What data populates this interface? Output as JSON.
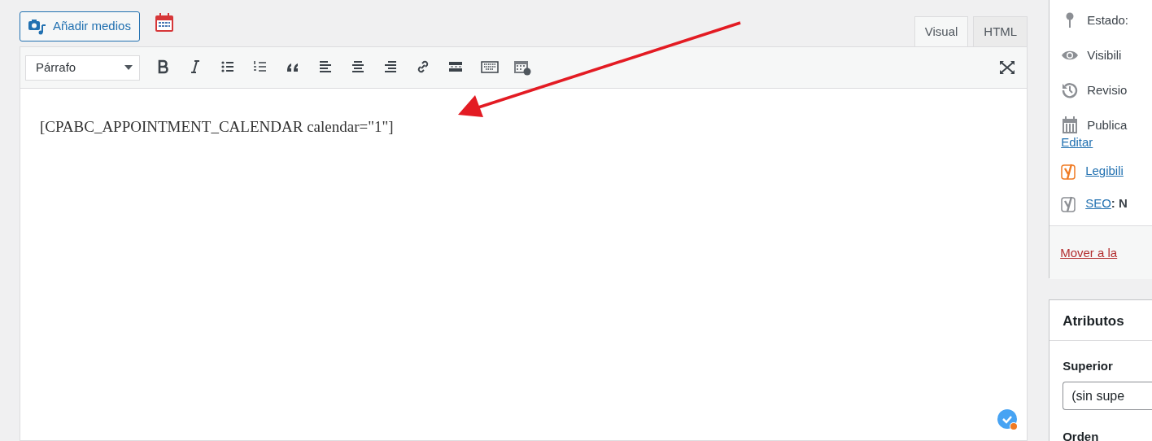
{
  "media_button": {
    "label": "Añadir medios"
  },
  "tabs": [
    {
      "label": "Visual",
      "selected": true
    },
    {
      "label": "HTML",
      "selected": false
    }
  ],
  "toolbar": {
    "format_select": "Párrafo"
  },
  "editor": {
    "content": "[CPABC_APPOINTMENT_CALENDAR calendar=\"1\"]"
  },
  "publish_box": {
    "rows": [
      {
        "kind": "status",
        "label": "Estado:"
      },
      {
        "kind": "visibility",
        "label": "Visibili"
      },
      {
        "kind": "revisions",
        "label": "Revisio"
      },
      {
        "kind": "date",
        "label": "Publica",
        "link": "Editar"
      }
    ],
    "ratings": [
      {
        "kind": "readability",
        "link": "Legibili"
      },
      {
        "kind": "seo",
        "link": "SEO",
        "suffix": ": N"
      }
    ],
    "trash_link": "Mover a la"
  },
  "attributes_box": {
    "title": "Atributos",
    "parent_label": "Superior",
    "parent_value": "(sin supe",
    "order_label": "Orden"
  }
}
